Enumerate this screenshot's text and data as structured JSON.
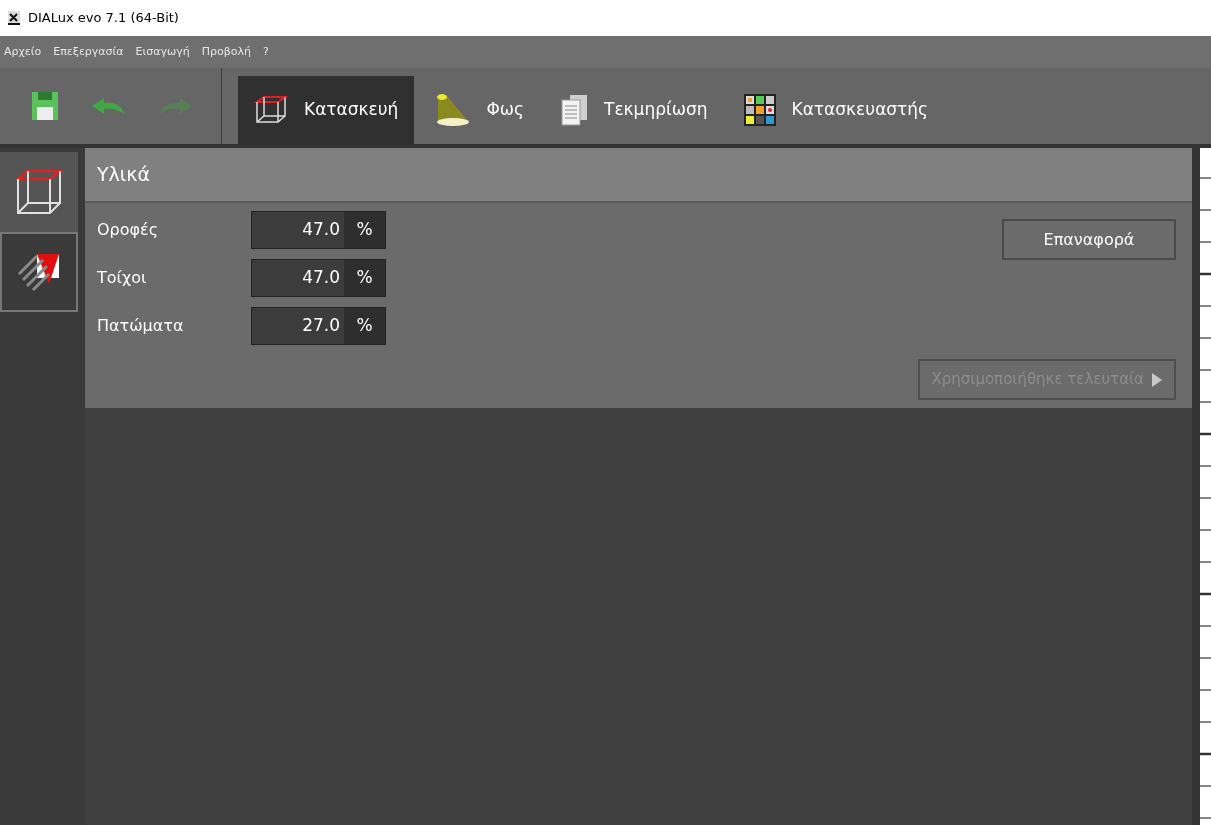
{
  "window": {
    "title": "DIALux evo 7.1  (64-Bit)"
  },
  "menu": [
    "Αρχείο",
    "Επεξεργασία",
    "Εισαγωγή",
    "Προβολή",
    "?"
  ],
  "toolbar": [
    {
      "kind": "save",
      "disabled": false
    },
    {
      "kind": "undo",
      "disabled": false
    },
    {
      "kind": "redo",
      "disabled": true
    }
  ],
  "tabs": [
    {
      "label": "Κατασκευή",
      "kind": "construction",
      "selected": true
    },
    {
      "label": "Φως",
      "kind": "light",
      "selected": false
    },
    {
      "label": "Τεκμηρίωση",
      "kind": "documentation",
      "selected": false
    },
    {
      "label": "Κατασκευαστής",
      "kind": "manufacturer",
      "selected": false
    }
  ],
  "side_tools": [
    {
      "kind": "cube",
      "selected": false
    },
    {
      "kind": "material",
      "selected": true
    }
  ],
  "panel": {
    "title": "Υλικά",
    "rows": [
      {
        "label": "Οροφές",
        "value": "47.0",
        "unit": "%"
      },
      {
        "label": "Τοίχοι",
        "value": "47.0",
        "unit": "%"
      },
      {
        "label": "Πατώματα",
        "value": "27.0",
        "unit": "%"
      }
    ],
    "reset_button": {
      "label": "Επαναφορά",
      "disabled": false
    },
    "recent_button": {
      "label": "Χρησιμοποιήθηκε τελευταία",
      "disabled": true
    }
  }
}
